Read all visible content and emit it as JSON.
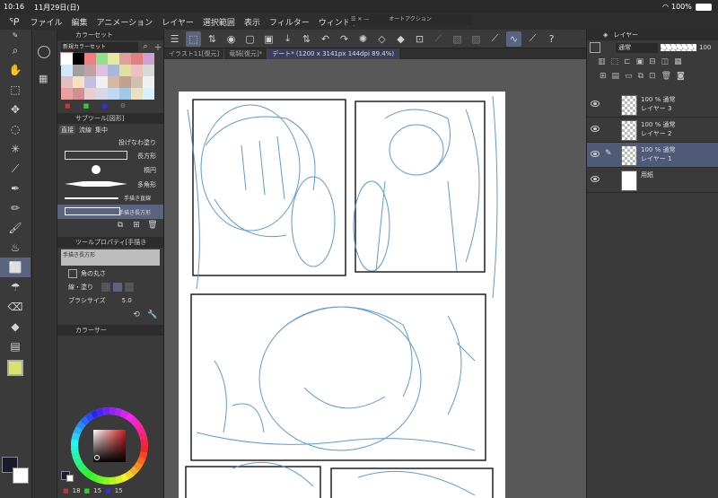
{
  "status": {
    "time": "10:16",
    "date": "11月29日(日)",
    "battery": "100%"
  },
  "menu": [
    "ファイル",
    "編集",
    "アニメーション",
    "レイヤー",
    "選択範囲",
    "表示",
    "フィルター",
    "ウィンドウ"
  ],
  "float_panel": {
    "title": "オートアクション"
  },
  "tabs": [
    {
      "label": "イラスト11[復元]"
    },
    {
      "label": "竜騎[復元]*"
    },
    {
      "label": "デート* (1200 x 3141px 144dpi 89.4%)"
    }
  ],
  "color_set": {
    "title": "カラーセット",
    "set_name": "新規カラーセット",
    "colors": [
      "#ffffff",
      "#000000",
      "#f08080",
      "#90e090",
      "#e8e8a0",
      "#e0a0a0",
      "#e08080",
      "#d0a0d0",
      "#d0e8f8",
      "#a0a0a0",
      "#c0a0a0",
      "#e0c0e0",
      "#a8b8d8",
      "#e0e0a0",
      "#f0c0c0",
      "#d8d8d8",
      "#e0c0c0",
      "#f8e0c0",
      "#c0c0e0",
      "#f0f0f0",
      "#d8b8a0",
      "#c0a090",
      "#d0c0b0",
      "#f0f0f0",
      "#e8a0a0",
      "#d09090",
      "#e8d0d0",
      "#d8d8e8",
      "#c0d8f0",
      "#a0c8e8",
      "#e8e0c0",
      "#d8f0f8"
    ]
  },
  "sub_tool": {
    "title": "サブツール[図形]",
    "tabs": [
      "直接",
      "流線",
      "集中"
    ],
    "items": [
      {
        "label": "投げなわ塗り"
      },
      {
        "label": "長方形"
      },
      {
        "label": "楕円"
      },
      {
        "label": "多角形"
      },
      {
        "label": "手描き直線"
      },
      {
        "label": "手描き長方形"
      }
    ]
  },
  "tool_property": {
    "title": "ツールプロパティ[手描き",
    "preset": "手描き長方形",
    "corner": "角の丸さ",
    "line_fill": "線・塗り",
    "brush_size_label": "ブラシサイズ",
    "brush_size": "5.0"
  },
  "color_circle": {
    "title": "カラーサー",
    "values": [
      "18",
      "15",
      "15"
    ]
  },
  "layer_panel": {
    "title": "レイヤー",
    "blend": "通常",
    "opacity": "100",
    "layers": [
      {
        "opacity": "100 % 通常",
        "name": "レイヤー 3",
        "selected": false
      },
      {
        "opacity": "100 % 通常",
        "name": "レイヤー 2",
        "selected": false
      },
      {
        "opacity": "100 % 通常",
        "name": "レイヤー 1",
        "selected": true
      },
      {
        "opacity": "",
        "name": "用紙",
        "selected": false
      }
    ]
  },
  "colors": {
    "accent": "#5a6480",
    "sketch": "#4a90d9",
    "panel_bg": "#3a3a3a",
    "canvas_bg": "#585858"
  }
}
